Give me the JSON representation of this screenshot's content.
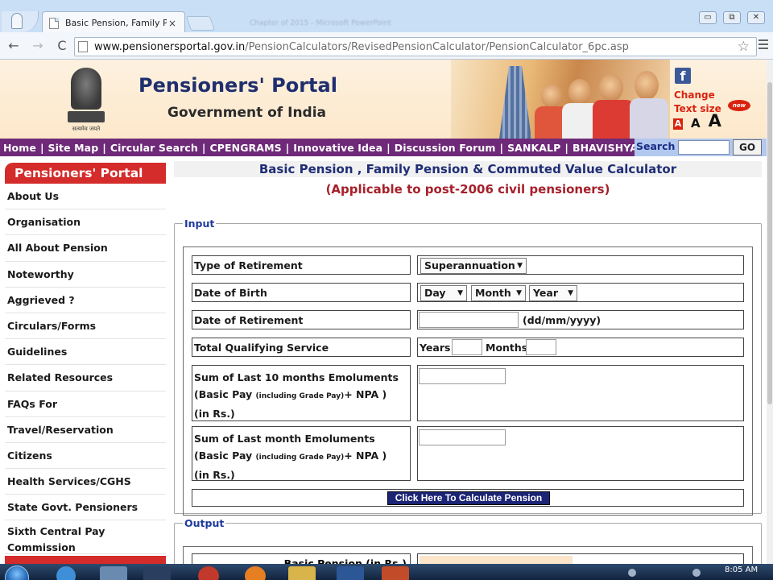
{
  "browser": {
    "tab_title": "Basic Pension, Family Pen",
    "tab_close": "×",
    "ghost_tab_title": "Chapter of 2015 - Microsoft PowerPoint",
    "url_domain": "www.pensionersportal.gov.in",
    "url_path": "/PensionCalculators/RevisedPensionCalculator/PensionCalculator_6pc.asp",
    "back": "←",
    "forward": "→",
    "reload": "C",
    "star": "☆",
    "minimize": "▭",
    "restore": "⧉",
    "close": "✕"
  },
  "header": {
    "title": "Pensioners' Portal",
    "subtitle": "Government of India",
    "emblem_motto": "सत्यमेव जयते",
    "facebook": "f",
    "change_text_line1": "Change",
    "change_text_line2": "Text size",
    "new_badge": "new",
    "size_small": "A",
    "size_medium": "A",
    "size_large": "A"
  },
  "top_nav": {
    "items": [
      "Home",
      "Site Map",
      "Circular Search",
      "CPENGRAMS",
      "Innovative Idea",
      "Discussion Forum",
      "SANKALP",
      "BHAVISHYA"
    ],
    "separator": "|",
    "search_label": "Search",
    "go_label": "GO"
  },
  "sidebar": {
    "header": "Pensioners' Portal",
    "items": [
      "About Us",
      "Organisation",
      "All About Pension",
      "Noteworthy",
      "Aggrieved ?",
      "Circulars/Forms",
      "Guidelines",
      "Related Resources",
      "FAQs For",
      "Travel/Reservation",
      "Citizens",
      "Health Services/CGHS",
      "State Govt. Pensioners"
    ],
    "last_item_line1": "Sixth Central Pay",
    "last_item_line2": "Commission"
  },
  "main": {
    "title": "Basic Pension , Family Pension & Commuted Value Calculator",
    "subtitle": "(Applicable to post-2006 civil pensioners)",
    "input_legend": "Input",
    "output_legend": "Output",
    "rows": {
      "type_of_retirement": "Type of Retirement",
      "date_of_birth": "Date of Birth",
      "date_of_retirement": "Date of Retirement",
      "total_qualifying_service": "Total Qualifying Service"
    },
    "retirement_select": "Superannuation",
    "dob_day": "Day",
    "dob_month": "Month",
    "dob_year": "Year",
    "date_format_hint": "(dd/mm/yyyy)",
    "years_label": "Years",
    "months_label": "Months",
    "emol10": {
      "line1": "Sum of Last 10 months Emoluments",
      "line2_a": "(Basic Pay ",
      "line2_small": "(including Grade Pay)",
      "line2_b": "+ NPA   )",
      "line3": "(in Rs.)"
    },
    "emol1": {
      "line1": "Sum of Last month Emoluments",
      "line2_a": "(Basic Pay ",
      "line2_small": "(including Grade Pay)",
      "line2_b": "+ NPA   )",
      "line3": "(in Rs.)"
    },
    "calculate_button": "Click Here To Calculate Pension",
    "basic_pension_label": "Basic Pension (in Rs.)",
    "basic_pension_value": ""
  },
  "taskbar": {
    "clock": "8:05 AM"
  },
  "colors": {
    "nav_purple": "#6e2979",
    "sidebar_red": "#d42b2b",
    "title_blue": "#1f2e76",
    "subtitle_red": "#a5202a",
    "button_navy": "#1b2475"
  }
}
